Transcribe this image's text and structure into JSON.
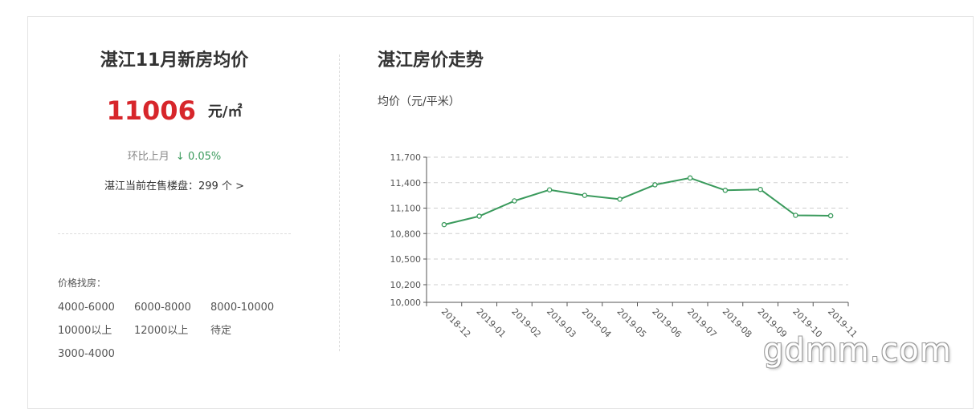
{
  "summary": {
    "title": "湛江11月新房均价",
    "price": "11006",
    "unit": "元/㎡",
    "mom_label": "环比上月",
    "mom_arrow": "↓",
    "mom_value": "0.05%",
    "selling_text": "湛江当前在售楼盘：299 个 >",
    "price_color": "#d7262b",
    "down_color": "#3a9a5c"
  },
  "filter": {
    "label": "价格找房：",
    "items": [
      "4000-6000",
      "6000-8000",
      "8000-10000",
      "10000以上",
      "12000以上",
      "待定",
      "3000-4000"
    ]
  },
  "trend": {
    "title": "湛江房价走势",
    "y_unit": "均价（元/平米）"
  },
  "watermark": "gdmm.com",
  "chart_data": {
    "type": "line",
    "title": "",
    "xlabel": "",
    "ylabel": "均价（元/平米）",
    "categories": [
      "2018-12",
      "2019-01",
      "2019-02",
      "2019-03",
      "2019-04",
      "2019-05",
      "2019-06",
      "2019-07",
      "2019-08",
      "2019-09",
      "2019-10",
      "2019-11"
    ],
    "series": [
      {
        "values": [
          10905,
          11005,
          11185,
          11315,
          11250,
          11205,
          11375,
          11455,
          11310,
          11320,
          11015,
          11010
        ],
        "color": "#3a9a5c"
      }
    ],
    "ylim": [
      10000,
      11700
    ],
    "yticks": [
      10000,
      10200,
      10500,
      10800,
      11100,
      11400,
      11700
    ],
    "ytick_labels": [
      "10,000",
      "10,200",
      "10,500",
      "10,800",
      "11,100",
      "11,400",
      "11,700"
    ],
    "grid": true,
    "legend": "none"
  }
}
